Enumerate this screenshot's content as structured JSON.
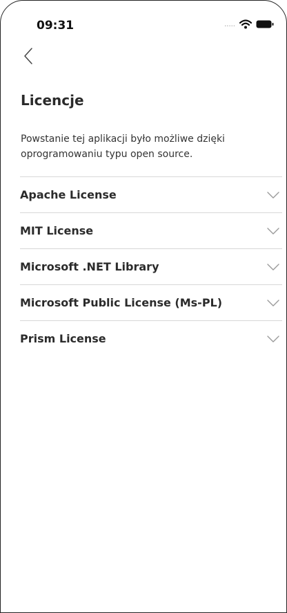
{
  "status_bar": {
    "time": "09:31",
    "signal": ".....",
    "icons": [
      "wifi-icon",
      "battery-icon"
    ]
  },
  "header": {
    "back_icon": "chevron-left-icon",
    "title": "Licencje"
  },
  "main": {
    "description": "Powstanie tej aplikacji było możliwe dzięki oprogramowaniu typu open source.",
    "licenses": [
      {
        "label": "Apache License",
        "icon": "chevron-down-icon"
      },
      {
        "label": "MIT License",
        "icon": "chevron-down-icon"
      },
      {
        "label": "Microsoft .NET Library",
        "icon": "chevron-down-icon"
      },
      {
        "label": "Microsoft Public License (Ms-PL)",
        "icon": "chevron-down-icon"
      },
      {
        "label": "Prism License",
        "icon": "chevron-down-icon"
      }
    ]
  },
  "colors": {
    "text": "#2b2b2b",
    "divider": "#d7d7d7",
    "chevron": "#9a9a9a"
  }
}
